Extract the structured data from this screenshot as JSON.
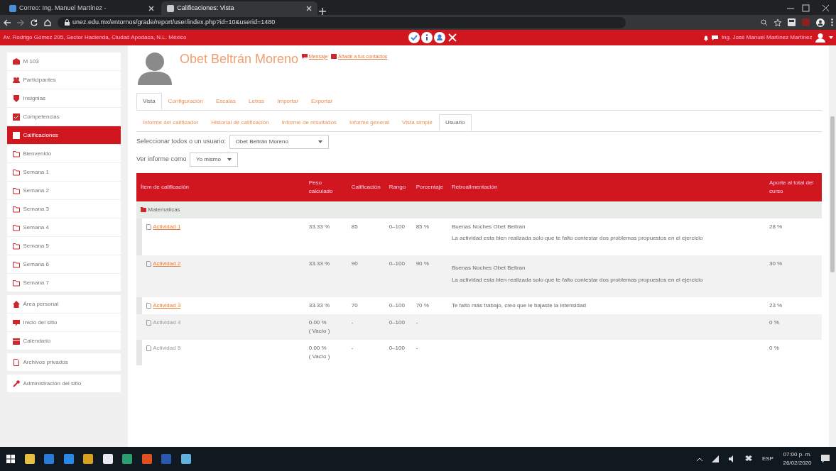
{
  "browser": {
    "tabs": [
      {
        "title": "Correo: Ing. Manuel Martínez -",
        "selected": false
      },
      {
        "title": "Calificaciones: Vista",
        "selected": true
      }
    ],
    "url": "unez.edu.mx/entornos/grade/report/user/index.php?id=10&userid=1480"
  },
  "topbar": {
    "address": "Av. Rodrigo Gómez 205, Sector Hacienda, Ciudad Apodaca, N.L. México",
    "user": "Ing. José Manuel Martínez Martínez"
  },
  "sidebar": {
    "items": [
      {
        "label": "M 103",
        "kind": "course",
        "selected": false
      },
      {
        "label": "Participantes",
        "kind": "people",
        "selected": false
      },
      {
        "label": "Insignias",
        "kind": "badge",
        "selected": false
      },
      {
        "label": "Competencias",
        "kind": "check",
        "selected": false
      },
      {
        "label": "Calificaciones",
        "kind": "table",
        "selected": true
      },
      {
        "label": "Bienvenido",
        "kind": "folder",
        "selected": false
      },
      {
        "label": "Semana 1",
        "kind": "folder",
        "selected": false
      },
      {
        "label": "Semana 2",
        "kind": "folder",
        "selected": false
      },
      {
        "label": "Semana 3",
        "kind": "folder",
        "selected": false
      },
      {
        "label": "Semana 4",
        "kind": "folder",
        "selected": false
      },
      {
        "label": "Semana 5",
        "kind": "folder",
        "selected": false
      },
      {
        "label": "Semana 6",
        "kind": "folder",
        "selected": false
      },
      {
        "label": "Semana 7",
        "kind": "folder",
        "selected": false
      },
      {
        "label": "Área personal",
        "kind": "home",
        "selected": false
      },
      {
        "label": "Inicio del sitio",
        "kind": "site",
        "selected": false
      },
      {
        "label": "Calendario",
        "kind": "calendar",
        "selected": false
      },
      {
        "label": "Archivos privados",
        "kind": "file",
        "selected": false
      },
      {
        "label": "Administración del sitio",
        "kind": "wrench",
        "selected": false
      }
    ]
  },
  "profile": {
    "name": "Obet Beltrán Moreno",
    "links": [
      "Mensaje",
      "Añadir a tus contactos"
    ]
  },
  "tabs": [
    {
      "label": "Vista",
      "selected": true
    },
    {
      "label": "Configuración",
      "selected": false
    },
    {
      "label": "Escalas",
      "selected": false
    },
    {
      "label": "Letras",
      "selected": false
    },
    {
      "label": "Importar",
      "selected": false
    },
    {
      "label": "Exportar",
      "selected": false
    }
  ],
  "subtabs": [
    {
      "label": "Informe del calificador",
      "selected": false
    },
    {
      "label": "Historial de calificación",
      "selected": false
    },
    {
      "label": "Informe de resultados",
      "selected": false
    },
    {
      "label": "Informe general",
      "selected": false
    },
    {
      "label": "Vista simple",
      "selected": false
    },
    {
      "label": "Usuario",
      "selected": true
    }
  ],
  "filters": [
    {
      "label": "Seleccionar todos o un usuario:",
      "value": "Obet Beltrán Moreno"
    },
    {
      "label": "Ver informe como",
      "value": "Yo mismo"
    }
  ],
  "table": {
    "columns": [
      "Ítem de calificación",
      "Peso calculado",
      "Calificación",
      "Rango",
      "Porcentaje",
      "Retroalimentación",
      "Aporte al total del curso"
    ],
    "category": "Matemáticas",
    "rows": [
      {
        "item": "Actividad 1",
        "weight": "33.33 %",
        "weight_note": null,
        "grade": "85",
        "range": "0–100",
        "percent": "85 %",
        "feedback": [
          "Buenas Noches Obet Beltran",
          "La actividad esta bien realizada solo que te falto contestar dos problemas propuestos en el ejercicio"
        ],
        "contribution": "28 %"
      },
      {
        "item": "Actividad 2",
        "weight": "33.33 %",
        "weight_note": null,
        "grade": "90",
        "range": "0–100",
        "percent": "90 %",
        "feedback": [
          "Buenas Noches Obet Beltran",
          "La actividad esta bien realizada solo que te falto contestar dos problemas propuestos en el ejercicio"
        ],
        "contribution": "30 %"
      },
      {
        "item": "Actividad 3",
        "weight": "33.33 %",
        "weight_note": null,
        "grade": "70",
        "range": "0–100",
        "percent": "70 %",
        "feedback": [
          "Te faltó más trabajo, creo que le bajaste la intensidad"
        ],
        "contribution": "23 %"
      },
      {
        "item": "Actividad 4",
        "weight": "0.00 %",
        "weight_note": "( Vacío )",
        "grade": "-",
        "range": "0–100",
        "percent": "-",
        "feedback": [],
        "contribution": "0 %"
      },
      {
        "item": "Actividad 5",
        "weight": "0.00 %",
        "weight_note": "( Vacío )",
        "grade": "-",
        "range": "0–100",
        "percent": "-",
        "feedback": [],
        "contribution": "0 %"
      }
    ]
  },
  "taskbar": {
    "language": "ESP",
    "time": "07:00 p. m.",
    "date": "26/02/2020"
  }
}
